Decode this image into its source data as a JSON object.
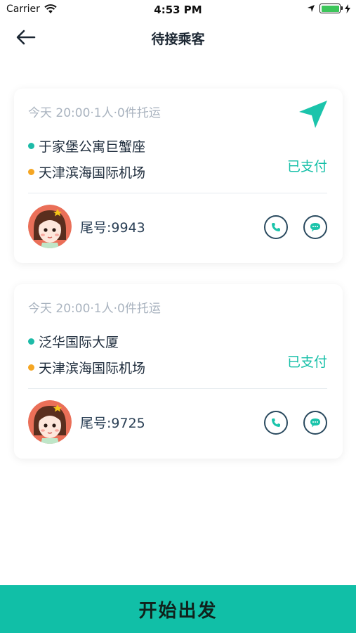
{
  "status_bar": {
    "carrier": "Carrier",
    "time": "4:53 PM"
  },
  "header": {
    "title": "待接乘客"
  },
  "colors": {
    "accent": "#11bfa7",
    "origin_dot": "#1dbba8",
    "dest_dot": "#f5a623"
  },
  "icons": {
    "back": "arrow-left-icon",
    "navigate": "navigation-arrow-icon",
    "phone": "phone-icon",
    "message": "chat-bubble-icon"
  },
  "orders": [
    {
      "meta": "今天 20:00·1人·0件托运",
      "origin": "于家堡公寓巨蟹座",
      "destination": "天津滨海国际机场",
      "status": "已支付",
      "tail": "尾号:9943"
    },
    {
      "meta": "今天 20:00·1人·0件托运",
      "origin": "泛华国际大厦",
      "destination": "天津滨海国际机场",
      "status": "已支付",
      "tail": "尾号:9725"
    }
  ],
  "footer": {
    "start_label": "开始出发"
  }
}
